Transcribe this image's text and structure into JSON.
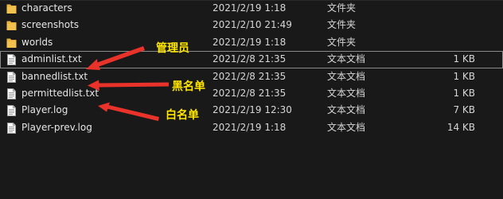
{
  "files": [
    {
      "name": "characters",
      "date": "2021/2/19 1:18",
      "type": "文件夹",
      "size": "",
      "icon": "folder-icon"
    },
    {
      "name": "screenshots",
      "date": "2021/2/10 21:49",
      "type": "文件夹",
      "size": "",
      "icon": "folder-icon"
    },
    {
      "name": "worlds",
      "date": "2021/2/19 1:18",
      "type": "文件夹",
      "size": "",
      "icon": "folder-icon"
    },
    {
      "name": "adminlist.txt",
      "date": "2021/2/8 21:35",
      "type": "文本文档",
      "size": "1 KB",
      "icon": "text-file-icon",
      "selected": true
    },
    {
      "name": "bannedlist.txt",
      "date": "2021/2/8 21:35",
      "type": "文本文档",
      "size": "1 KB",
      "icon": "text-file-icon"
    },
    {
      "name": "permittedlist.txt",
      "date": "2021/2/8 21:35",
      "type": "文本文档",
      "size": "1 KB",
      "icon": "text-file-icon"
    },
    {
      "name": "Player.log",
      "date": "2021/2/19 12:30",
      "type": "文本文档",
      "size": "7 KB",
      "icon": "text-file-icon"
    },
    {
      "name": "Player-prev.log",
      "date": "2021/2/19 1:18",
      "type": "文本文档",
      "size": "14 KB",
      "icon": "text-file-icon"
    }
  ],
  "annotations": {
    "admin": "管理员",
    "banned": "黑名单",
    "permitted": "白名单"
  },
  "colors": {
    "background": "#191919",
    "annotation_text": "#ffe600",
    "arrow": "#e8322a",
    "folder": "#e9b33d"
  }
}
